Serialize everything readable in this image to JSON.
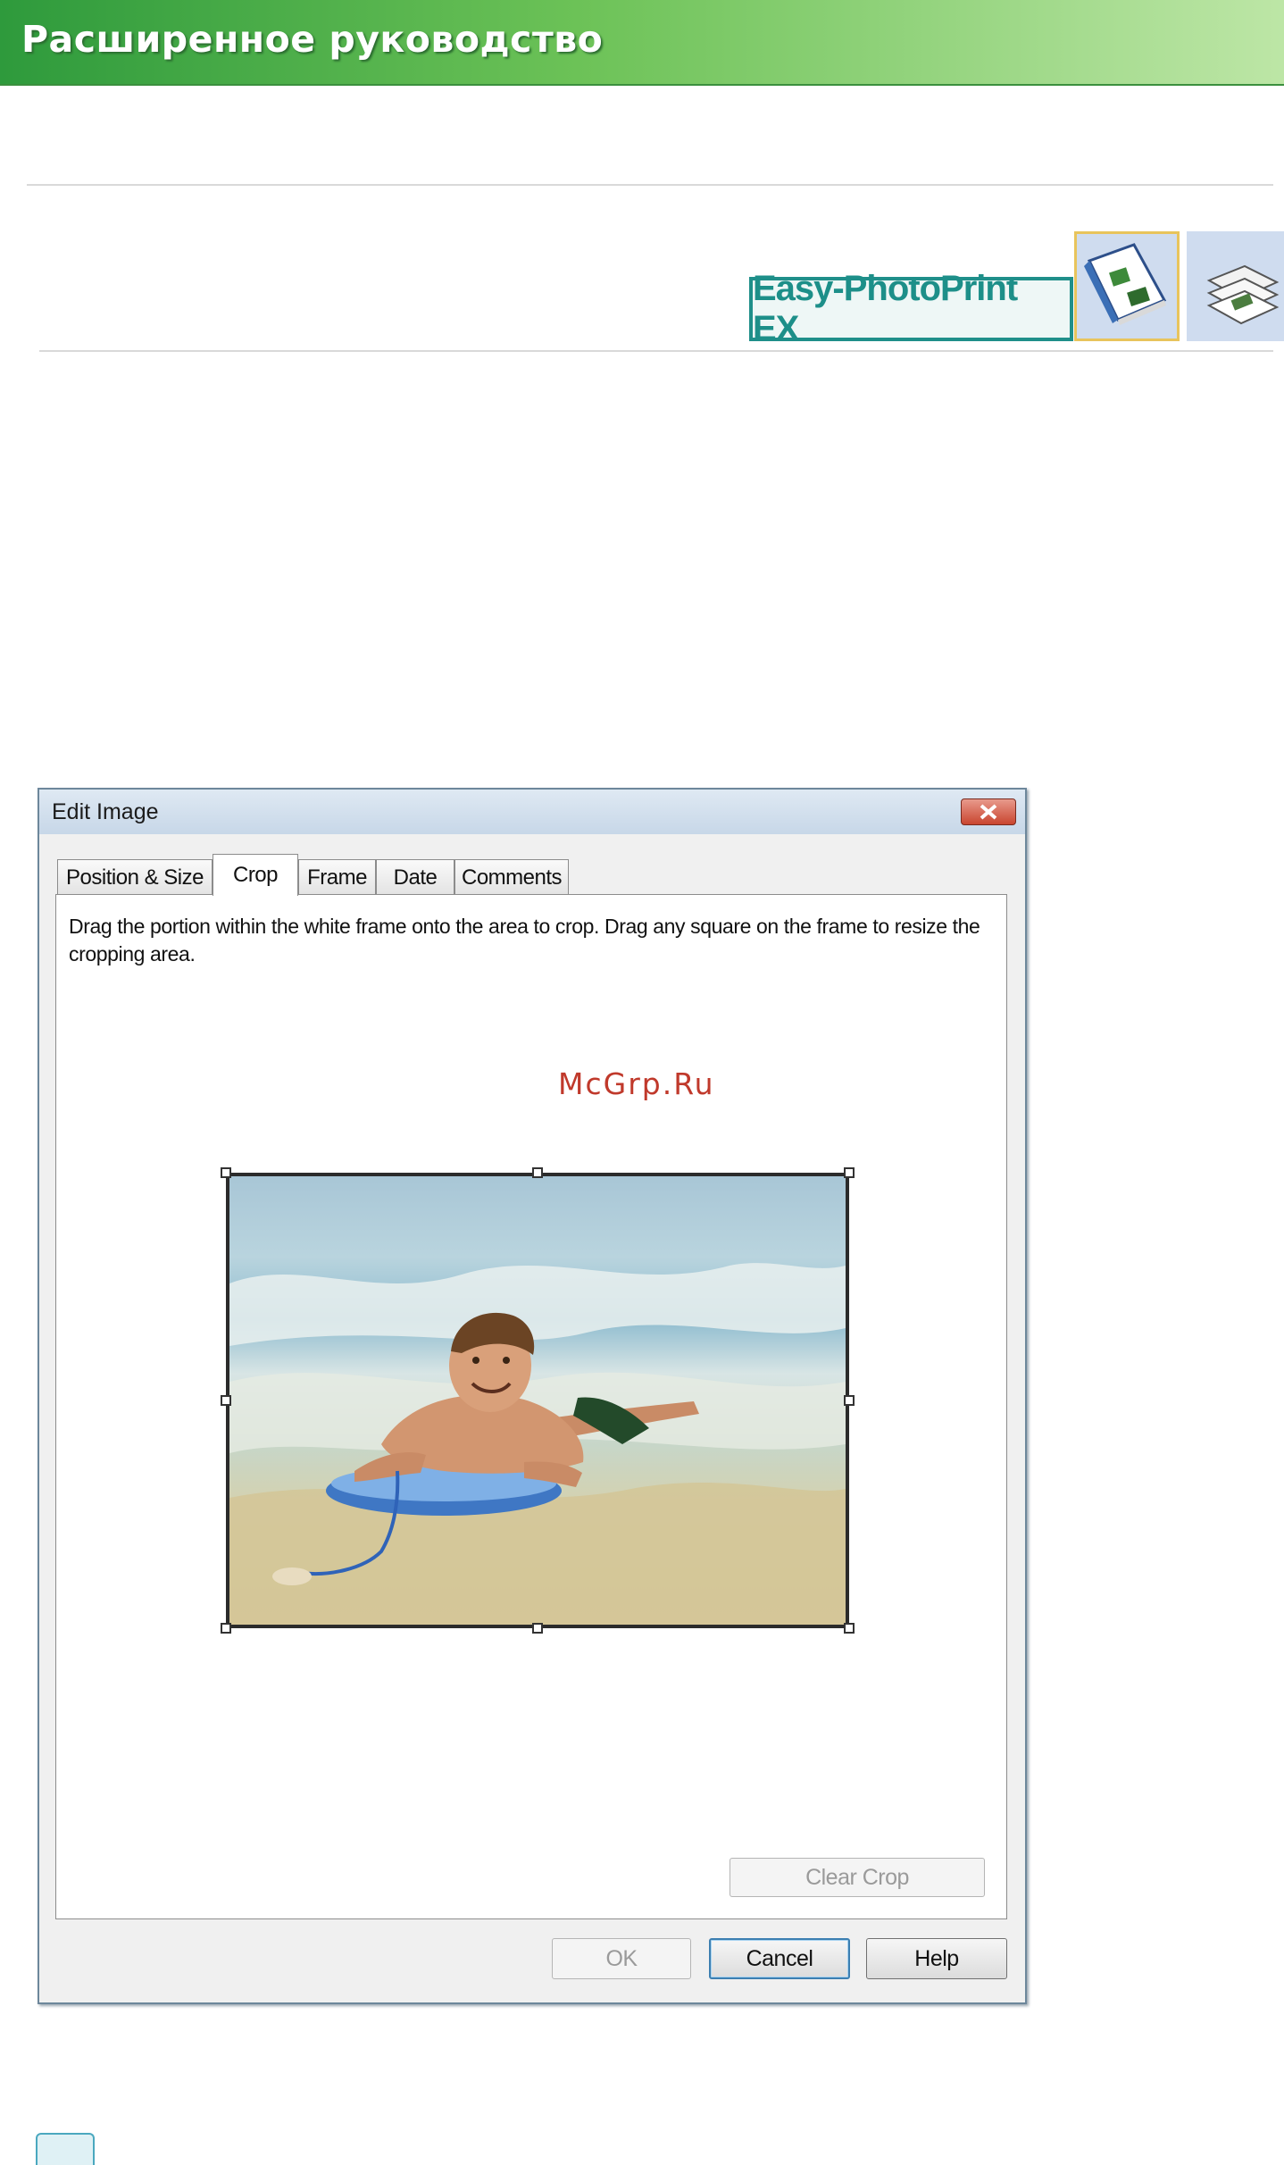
{
  "banner": {
    "title": "Расширенное руководство"
  },
  "product": {
    "logo_text": "Easy-PhotoPrint EX",
    "mode_icons": [
      "album-mode-icon",
      "photo-print-mode-icon"
    ]
  },
  "dialog": {
    "title": "Edit Image",
    "tabs": [
      {
        "label": "Position & Size",
        "active": false
      },
      {
        "label": "Crop",
        "active": true
      },
      {
        "label": "Frame",
        "active": false
      },
      {
        "label": "Date",
        "active": false
      },
      {
        "label": "Comments",
        "active": false
      }
    ],
    "instructions": "Drag the portion within the white frame onto the area to crop. Drag any square on the frame to resize the cropping area.",
    "watermark": "McGrp.Ru",
    "clear_crop_label": "Clear Crop",
    "ok_label": "OK",
    "cancel_label": "Cancel",
    "help_label": "Help"
  },
  "colors": {
    "banner_green": "#4fb04a",
    "logo_teal": "#1d8f89",
    "watermark_red": "#c0392b",
    "close_red": "#c9452f"
  }
}
